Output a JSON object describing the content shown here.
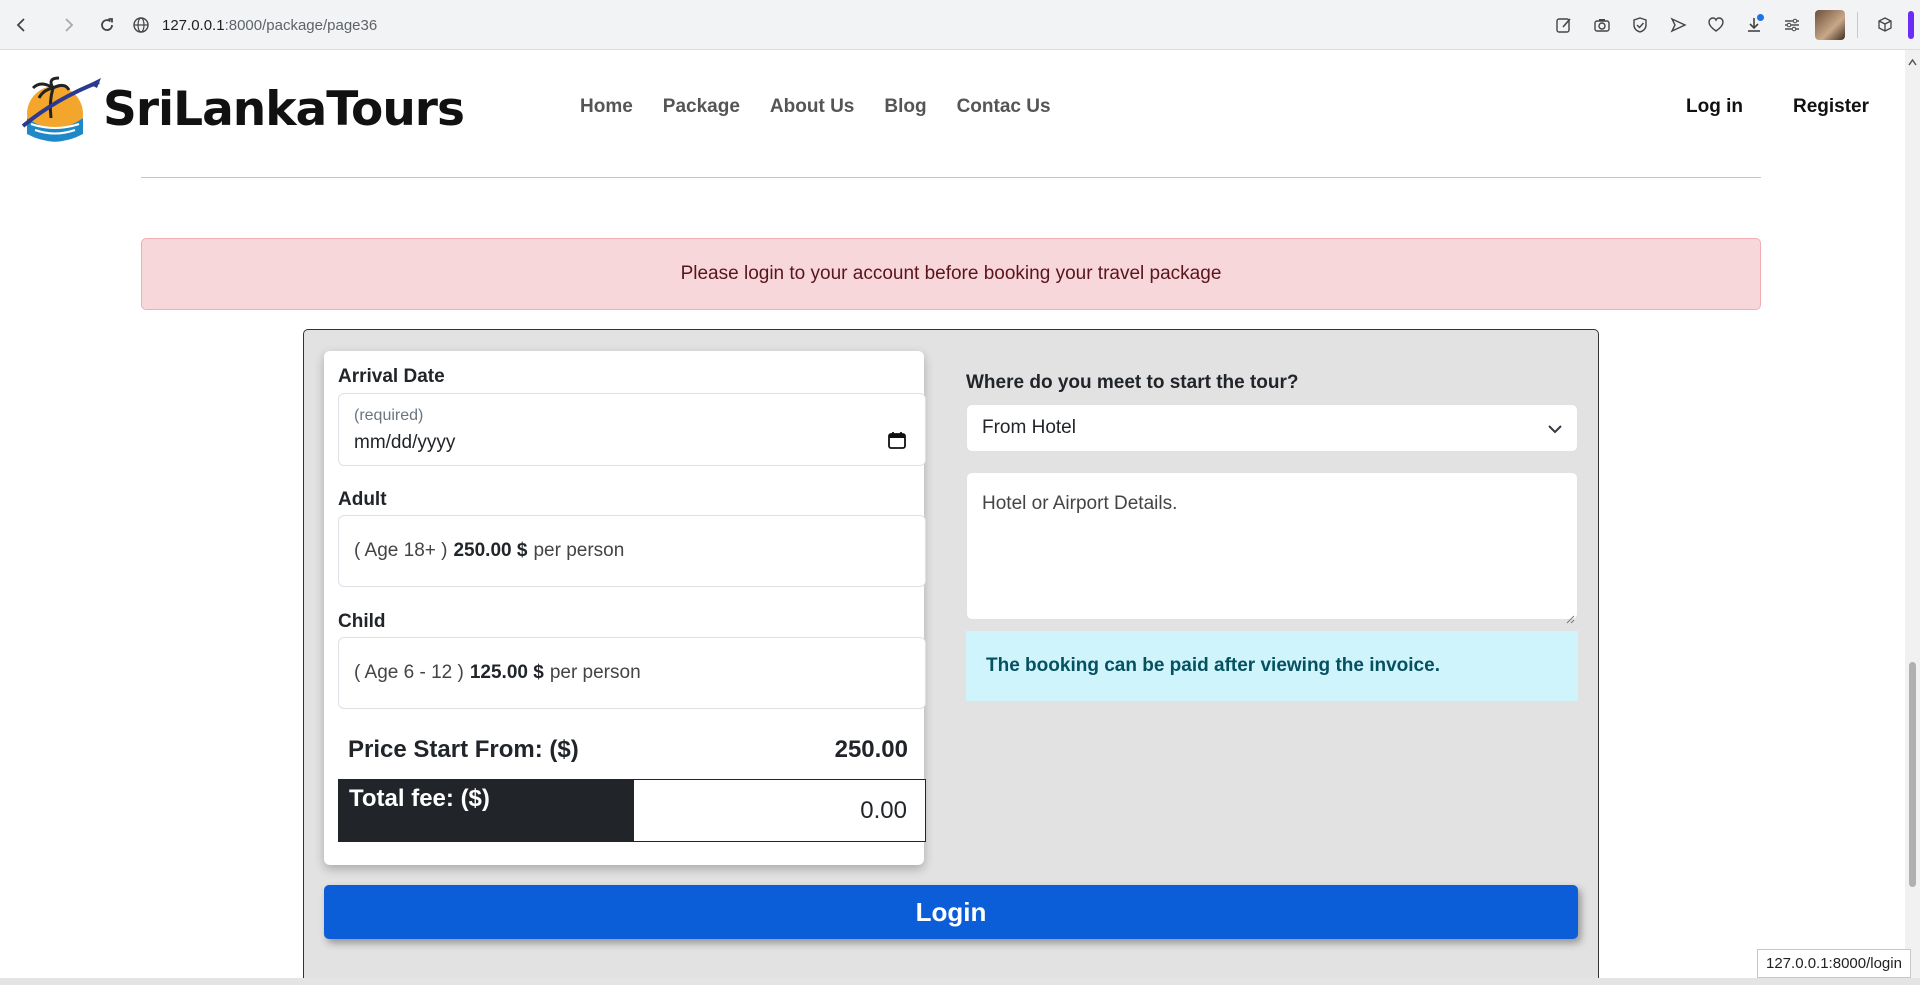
{
  "browser": {
    "url_host": "127.0.0.1",
    "url_path": ":8000/package/page36",
    "status_url": "127.0.0.1:8000/login"
  },
  "site": {
    "brand": "SriLankaTours",
    "nav": [
      "Home",
      "Package",
      "About Us",
      "Blog",
      "Contac Us"
    ],
    "auth": [
      "Log in",
      "Register"
    ]
  },
  "alert": {
    "text": "Please login to your account before booking your travel package"
  },
  "form": {
    "arrival_label": "Arrival Date",
    "arrival_hint": "(required)",
    "arrival_value": "mm/dd/yyyy",
    "adult_label": "Adult",
    "adult_prefix": "( Age 18+ )",
    "adult_price": "250.00 $",
    "adult_suffix": "per person",
    "child_label": "Child",
    "child_prefix": "( Age 6 - 12 )",
    "child_price": "125.00 $",
    "child_suffix": "per person",
    "price_label": "Price Start From: ($)",
    "price_value": "250.00",
    "total_label": "Total fee: ($)",
    "total_value": "0.00",
    "meet_label": "Where do you meet to start the tour?",
    "meet_selected": "From Hotel",
    "details_placeholder": "Hotel or Airport Details.",
    "info_text": "The booking can be paid after viewing the invoice.",
    "login_button": "Login"
  },
  "colors": {
    "primary": "#0b5ed7",
    "alert_bg": "#f8d7da",
    "info_bg": "#cff4fc",
    "dark": "#212529"
  }
}
